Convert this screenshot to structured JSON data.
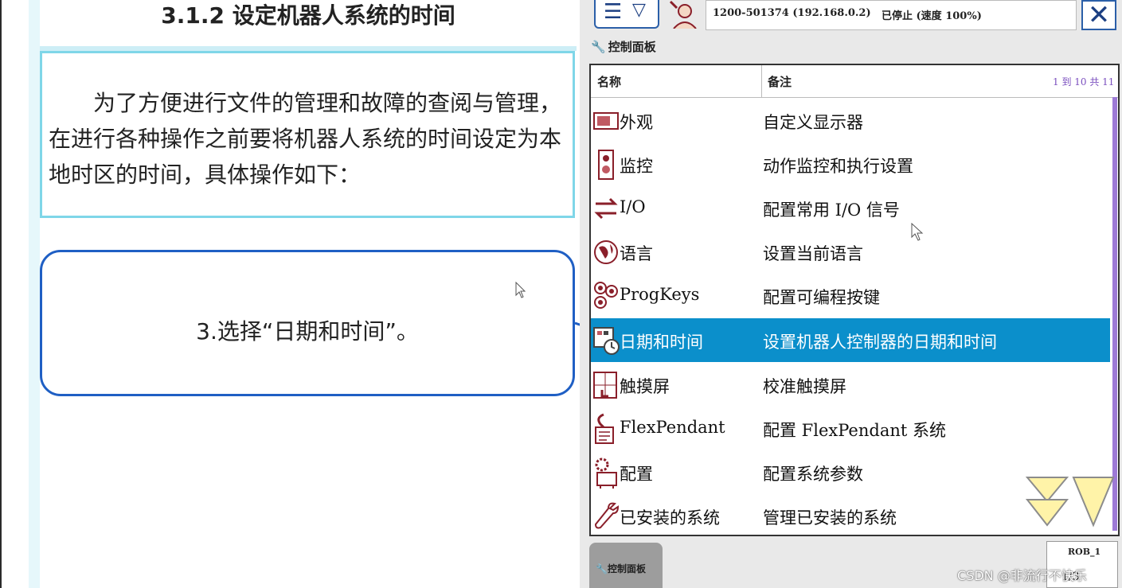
{
  "slide": {
    "title": "3.1.2 设定机器人系统的时间",
    "paragraph": "为了方便进行文件的管理和故障的查阅与管理，在进行各种操作之前要将机器人系统的时间设定为本地时区的时间，具体操作如下：",
    "step": "3.选择“日期和时间”。"
  },
  "pendant": {
    "status_id": "1200-501374 (192.168.0.2)",
    "status_state": "已停止 (速度 100%)",
    "breadcrumb": "控制面板",
    "table": {
      "col_name": "名称",
      "col_note": "备注",
      "page_info": "1 到 10 共 11",
      "rows": [
        {
          "name": "外观",
          "note": "自定义显示器",
          "icon": "appearance-icon"
        },
        {
          "name": "监控",
          "note": "动作监控和执行设置",
          "icon": "supervision-icon"
        },
        {
          "name": "I/O",
          "note": "配置常用 I/O 信号",
          "icon": "io-icon"
        },
        {
          "name": "语言",
          "note": "设置当前语言",
          "icon": "language-icon"
        },
        {
          "name": "ProgKeys",
          "note": "配置可编程按键",
          "icon": "progkeys-icon"
        },
        {
          "name": "日期和时间",
          "note": "设置机器人控制器的日期和时间",
          "icon": "date-time-icon",
          "selected": true
        },
        {
          "name": "触摸屏",
          "note": "校准触摸屏",
          "icon": "touchscreen-icon"
        },
        {
          "name": "FlexPendant",
          "note": "配置 FlexPendant 系统",
          "icon": "flexpendant-icon"
        },
        {
          "name": "配置",
          "note": "配置系统参数",
          "icon": "configuration-icon"
        },
        {
          "name": "已安装的系统",
          "note": "管理已安装的系统",
          "icon": "installed-systems-icon"
        }
      ]
    },
    "taskbar_tab": "控制面板",
    "rob_label": "ROB_1",
    "rob_sub": "1/3"
  },
  "watermark": "CSDN @非流行不快乐",
  "colors": {
    "selected_row": "#0b8fcb",
    "slide_border": "#7fd6e8",
    "step_border": "#1f5fc4",
    "scroll_arrow": "#fff3a8"
  }
}
